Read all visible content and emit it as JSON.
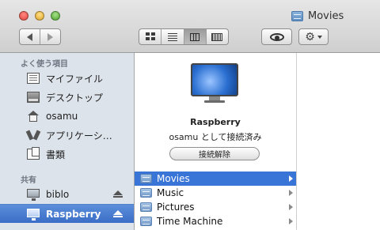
{
  "window": {
    "title": "Movies",
    "title_icon": "folder-icon"
  },
  "toolbar": {
    "nav": {
      "back_icon": "back-arrow-icon",
      "forward_icon": "forward-arrow-icon"
    },
    "view_modes": [
      {
        "name": "icon-view",
        "icon": "icon-view-icon",
        "active": false
      },
      {
        "name": "list-view",
        "icon": "list-view-icon",
        "active": false
      },
      {
        "name": "column-view",
        "icon": "column-view-icon",
        "active": true
      },
      {
        "name": "coverflow-view",
        "icon": "coverflow-view-icon",
        "active": false
      }
    ],
    "quicklook_icon": "eye-icon",
    "action_icon": "gear-icon"
  },
  "sidebar": {
    "favorites_header": "よく使う項目",
    "favorites": [
      {
        "label": "マイファイル",
        "icon": "all-my-files-icon"
      },
      {
        "label": "デスクトップ",
        "icon": "desktop-icon"
      },
      {
        "label": "osamu",
        "icon": "home-icon"
      },
      {
        "label": "アプリケーシ…",
        "icon": "applications-icon"
      },
      {
        "label": "書類",
        "icon": "documents-icon"
      }
    ],
    "shared_header": "共有",
    "shared": [
      {
        "label": "biblo",
        "icon": "monitor-icon",
        "selected": false
      },
      {
        "label": "Raspberry",
        "icon": "monitor-icon",
        "selected": true
      }
    ]
  },
  "preview": {
    "icon": "monitor-icon",
    "name": "Raspberry",
    "status": "osamu として接続済み",
    "disconnect_label": "接続解除"
  },
  "files": [
    {
      "name": "Movies",
      "selected": true
    },
    {
      "name": "Music",
      "selected": false
    },
    {
      "name": "Pictures",
      "selected": false
    },
    {
      "name": "Time Machine",
      "selected": false
    }
  ],
  "colors": {
    "selection": "#3875d7",
    "sidebar_bg": "#dde3ea"
  }
}
